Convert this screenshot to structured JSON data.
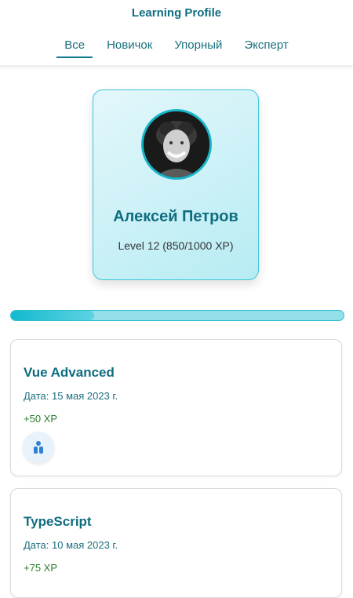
{
  "app": {
    "title": "Learning Profile"
  },
  "tabs": [
    {
      "label": "Все",
      "active": true
    },
    {
      "label": "Новичок",
      "active": false
    },
    {
      "label": "Упорный",
      "active": false
    },
    {
      "label": "Эксперт",
      "active": false
    }
  ],
  "profile": {
    "name": "Алексей Петров",
    "level_text": "Level 12 (850/1000 XP)"
  },
  "progress": {
    "fraction": 0.25
  },
  "courses": [
    {
      "title": "Vue Advanced",
      "date": "Дата: 15 мая 2023 г.",
      "xp": "+50 XP",
      "badge_icon": "people-icon"
    },
    {
      "title": "TypeScript",
      "date": "Дата: 10 мая 2023 г.",
      "xp": "+75 XP",
      "badge_icon": "people-icon"
    }
  ],
  "colors": {
    "accent": "#0f6d80",
    "progress": "#13b9cf",
    "xp": "#2e7d32"
  }
}
